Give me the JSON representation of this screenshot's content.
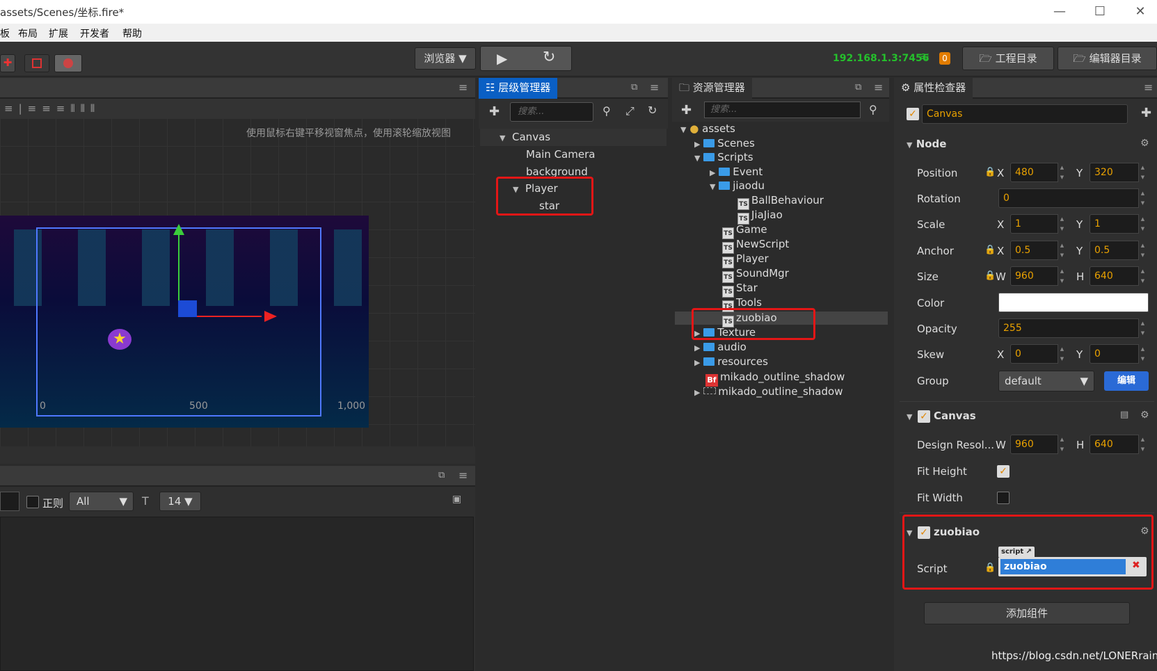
{
  "window": {
    "title": "assets/Scenes/坐标.fire*",
    "min": "—",
    "max": "☐",
    "close": "✕"
  },
  "menu": [
    "板",
    "布局",
    "扩展",
    "开发者",
    "帮助"
  ],
  "toolbar": {
    "browser": "浏览器 ▼",
    "play": "▶",
    "refresh": "↻",
    "ip": "192.168.1.3:7456",
    "badge": "0",
    "project_dir": "工程目录",
    "editor_dir": "编辑器目录"
  },
  "scene": {
    "hint": "使用鼠标右键平移视窗焦点，使用滚轮缩放视图",
    "ruler": [
      "0",
      "500",
      "1,000"
    ]
  },
  "console": {
    "regex_label": "正则",
    "filter": "All",
    "font_size": "14"
  },
  "hierarchy": {
    "tab": "层级管理器",
    "search_placeholder": "搜索...",
    "items": [
      "Canvas",
      "Main Camera",
      "background",
      "Player",
      "star"
    ]
  },
  "assets": {
    "tab": "资源管理器",
    "search_placeholder": "搜索...",
    "items": [
      "assets",
      "Scenes",
      "Scripts",
      "Event",
      "jiaodu",
      "BallBehaviour",
      "JiaJiao",
      "Game",
      "NewScript",
      "Player",
      "SoundMgr",
      "Star",
      "Tools",
      "zuobiao",
      "Texture",
      "audio",
      "resources",
      "mikado_outline_shadow",
      "mikado_outline_shadow"
    ],
    "bf": "Bf"
  },
  "inspector": {
    "tab": "属性检查器",
    "node_name": "Canvas",
    "node_section": "Node",
    "position": {
      "label": "Position",
      "x": "480",
      "y": "320"
    },
    "rotation": {
      "label": "Rotation",
      "v": "0"
    },
    "scale": {
      "label": "Scale",
      "x": "1",
      "y": "1"
    },
    "anchor": {
      "label": "Anchor",
      "x": "0.5",
      "y": "0.5"
    },
    "size": {
      "label": "Size",
      "w": "960",
      "h": "640"
    },
    "color": {
      "label": "Color"
    },
    "opacity": {
      "label": "Opacity",
      "v": "255"
    },
    "skew": {
      "label": "Skew",
      "x": "0",
      "y": "0"
    },
    "group": {
      "label": "Group",
      "v": "default",
      "edit": "编辑"
    },
    "canvas_section": "Canvas",
    "design": {
      "label": "Design Resol...",
      "w": "960",
      "h": "640"
    },
    "fit_height": "Fit Height",
    "fit_width": "Fit Width",
    "comp_section": "zuobiao",
    "script_label": "Script",
    "script_tag": "script",
    "script_value": "zuobiao",
    "add_component": "添加组件",
    "axis": {
      "x": "X",
      "y": "Y",
      "w": "W",
      "h": "H"
    }
  },
  "watermark": "https://blog.csdn.net/LONERrain"
}
